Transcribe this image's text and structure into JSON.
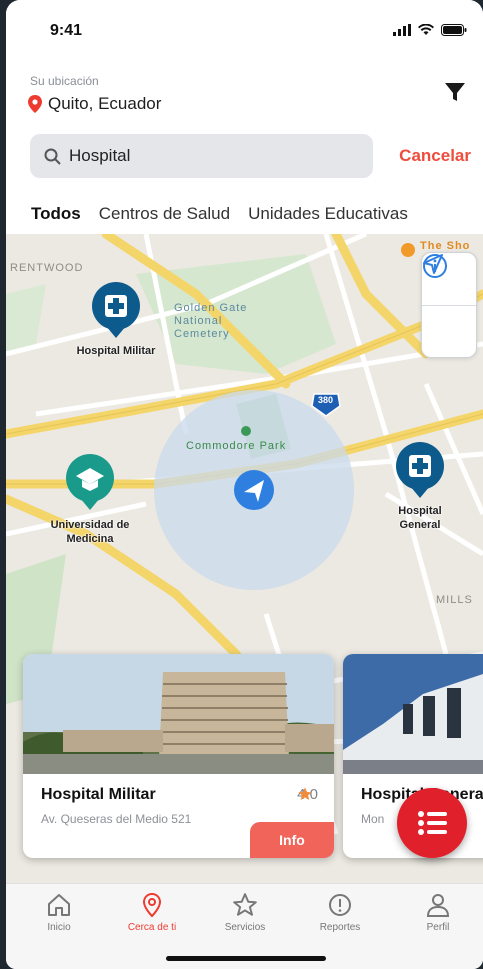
{
  "status_bar": {
    "time": "9:41"
  },
  "header": {
    "location_label": "Su ubicación",
    "location_value": "Quito, Ecuador",
    "search_value": "Hospital",
    "cancel_label": "Cancelar"
  },
  "tabs": [
    {
      "label": "Todos",
      "active": true
    },
    {
      "label": "Centros de Salud",
      "active": false
    },
    {
      "label": "Unidades Educativas",
      "active": false
    }
  ],
  "map": {
    "pois": [
      {
        "label": "Hospital Militar",
        "icon": "hospital-icon",
        "color": "#0d5a8c"
      },
      {
        "label": "Universidad de Medicina",
        "icon": "graduation-cap-icon",
        "color": "#1a9a8a"
      },
      {
        "label": "Hospital General",
        "icon": "hospital-icon",
        "color": "#0d5a8c"
      }
    ],
    "texts": {
      "park": "Commodore Park",
      "golden_gate": "Golden Gate National Cemetery",
      "brentwood": "RENTWOOD",
      "hills": "MILLS",
      "highway": "380",
      "the_shops": "The Sho"
    }
  },
  "cards": [
    {
      "title": "Hospital Militar",
      "address": "Av. Queseras del Medio 521",
      "rating": "4.0",
      "info_label": "Info"
    },
    {
      "title": "Hospital General",
      "address": "Mon",
      "rating": "",
      "info_label": ""
    }
  ],
  "bottom_nav": [
    {
      "label": "Inicio",
      "icon": "home-icon",
      "active": false
    },
    {
      "label": "Cerca de ti",
      "icon": "location-pin-icon",
      "active": true
    },
    {
      "label": "Servicios",
      "icon": "star-icon",
      "active": false
    },
    {
      "label": "Reportes",
      "icon": "alert-circle-icon",
      "active": false
    },
    {
      "label": "Perfil",
      "icon": "person-icon",
      "active": false
    }
  ],
  "colors": {
    "accent": "#ee3b30",
    "cancel": "#ee4d3d",
    "fab": "#e0202a",
    "info_button": "#f0645a",
    "hospital_marker": "#0d5a8c",
    "education_marker": "#1a9a8a"
  }
}
